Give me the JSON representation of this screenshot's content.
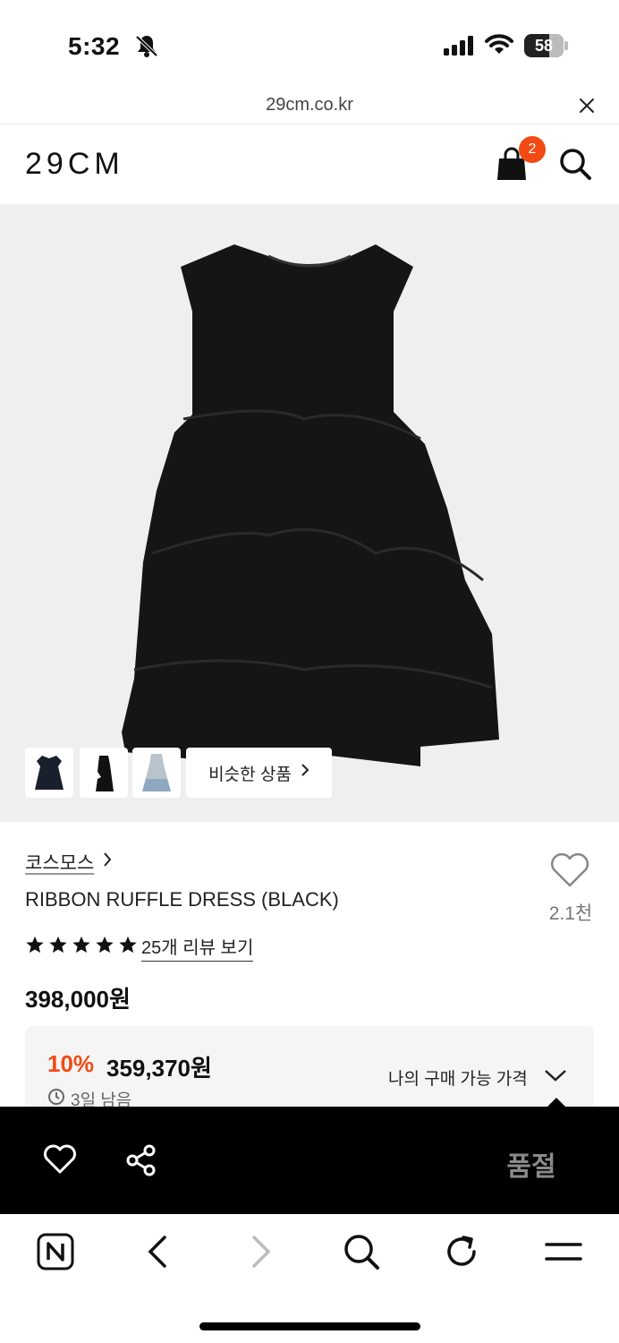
{
  "status_bar": {
    "time": "5:32",
    "battery": "58"
  },
  "browser": {
    "url": "29cm.co.kr"
  },
  "header": {
    "logo": "29CM",
    "cart_count": "2"
  },
  "gallery": {
    "similar_label": "비슷한 상품"
  },
  "product": {
    "brand": "코스모스",
    "name": "RIBBON RUFFLE DRESS (BLACK)",
    "like_count": "2.1천",
    "rating_stars": 5,
    "review_link": "25개 리뷰 보기",
    "price": "398,000원",
    "discount_percent": "10%",
    "sale_price": "359,370원",
    "remaining": "3일 남음",
    "my_price_label": "나의 구매 가능 가격"
  },
  "action_bar": {
    "soldout_label": "품절"
  },
  "colors": {
    "accent": "#f24a14"
  }
}
